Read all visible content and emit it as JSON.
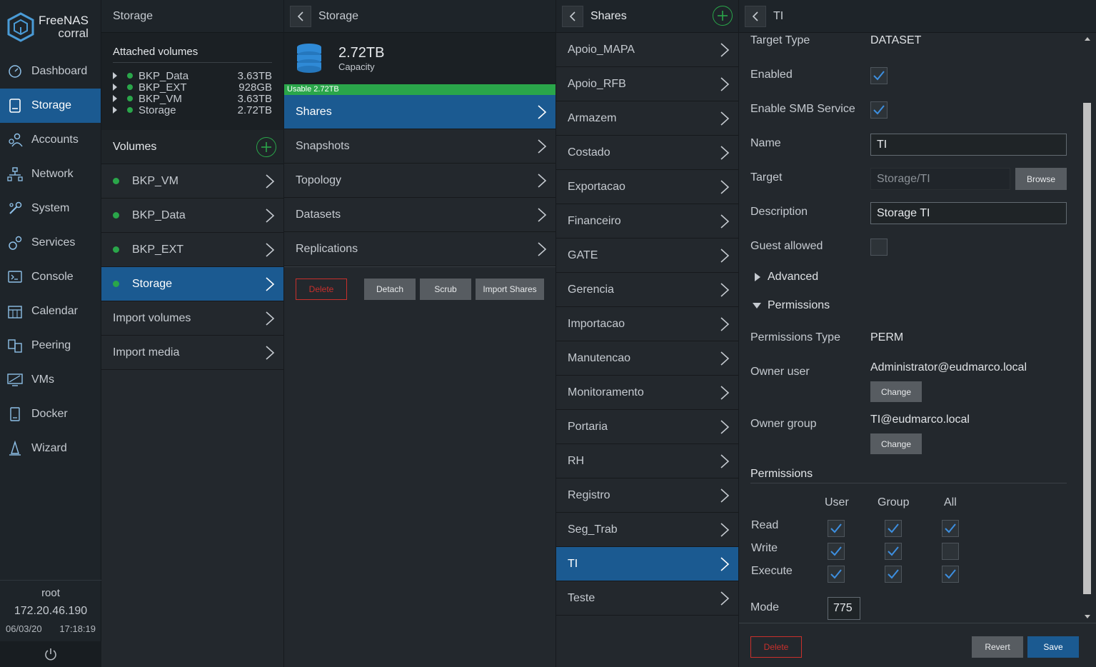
{
  "brand": {
    "line1": "FreeNAS",
    "line2": "corral"
  },
  "nav": {
    "items": [
      {
        "label": "Dashboard",
        "icon": "dashboard-icon"
      },
      {
        "label": "Storage",
        "icon": "storage-icon"
      },
      {
        "label": "Accounts",
        "icon": "accounts-icon"
      },
      {
        "label": "Network",
        "icon": "network-icon"
      },
      {
        "label": "System",
        "icon": "system-icon"
      },
      {
        "label": "Services",
        "icon": "services-icon"
      },
      {
        "label": "Console",
        "icon": "console-icon"
      },
      {
        "label": "Calendar",
        "icon": "calendar-icon"
      },
      {
        "label": "Peering",
        "icon": "peering-icon"
      },
      {
        "label": "VMs",
        "icon": "vms-icon"
      },
      {
        "label": "Docker",
        "icon": "docker-icon"
      },
      {
        "label": "Wizard",
        "icon": "wizard-icon"
      }
    ],
    "active": "Storage"
  },
  "footer": {
    "user": "root",
    "ip": "172.20.46.190",
    "date": "06/03/20",
    "time": "17:18:19"
  },
  "col1": {
    "title": "Storage",
    "attached_title": "Attached volumes",
    "attached": [
      {
        "name": "BKP_Data",
        "size": "3.63TB"
      },
      {
        "name": "BKP_EXT",
        "size": "928GB"
      },
      {
        "name": "BKP_VM",
        "size": "3.63TB"
      },
      {
        "name": "Storage",
        "size": "2.72TB"
      }
    ],
    "volumes_title": "Volumes",
    "volumes": [
      "BKP_VM",
      "BKP_Data",
      "BKP_EXT",
      "Storage"
    ],
    "extra": [
      "Import volumes",
      "Import media"
    ]
  },
  "col2": {
    "title": "Storage",
    "capacity_value": "2.72TB",
    "capacity_label": "Capacity",
    "usable": "Usable 2.72TB",
    "items": [
      "Shares",
      "Snapshots",
      "Topology",
      "Datasets",
      "Replications"
    ],
    "buttons": {
      "delete": "Delete",
      "detach": "Detach",
      "scrub": "Scrub",
      "import": "Import Shares"
    }
  },
  "col3": {
    "title": "Shares",
    "items": [
      "Apoio_MAPA",
      "Apoio_RFB",
      "Armazem",
      "Costado",
      "Exportacao",
      "Financeiro",
      "GATE",
      "Gerencia",
      "Importacao",
      "Manutencao",
      "Monitoramento",
      "Portaria",
      "RH",
      "Registro",
      "Seg_Trab",
      "TI",
      "Teste"
    ],
    "active": "TI"
  },
  "detail": {
    "title": "TI",
    "target_type_label": "Target Type",
    "target_type_value": "DATASET",
    "enabled_label": "Enabled",
    "smb_label": "Enable SMB Service",
    "name_label": "Name",
    "name_value": "TI",
    "target_label": "Target",
    "target_placeholder": "Storage/TI",
    "browse": "Browse",
    "desc_label": "Description",
    "desc_value": "Storage TI",
    "guest_label": "Guest allowed",
    "advanced": "Advanced",
    "permissions_section": "Permissions",
    "perm_type_label": "Permissions Type",
    "perm_type_value": "PERM",
    "owner_user_label": "Owner user",
    "owner_user_value": "Administrator@eudmarco.local",
    "owner_group_label": "Owner group",
    "owner_group_value": "TI@eudmarco.local",
    "change": "Change",
    "perm_table_title": "Permissions",
    "perm_cols": [
      "User",
      "Group",
      "All"
    ],
    "perm_rows": [
      {
        "label": "Read",
        "values": [
          true,
          true,
          true
        ]
      },
      {
        "label": "Write",
        "values": [
          true,
          true,
          false
        ]
      },
      {
        "label": "Execute",
        "values": [
          true,
          true,
          true
        ]
      }
    ],
    "mode_label": "Mode",
    "mode_value": "775",
    "delete": "Delete",
    "revert": "Revert",
    "save": "Save"
  },
  "colors": {
    "accent": "#1b5a91",
    "green": "#2aa64a",
    "danger": "#c9302c",
    "check": "#3d8fe0"
  }
}
